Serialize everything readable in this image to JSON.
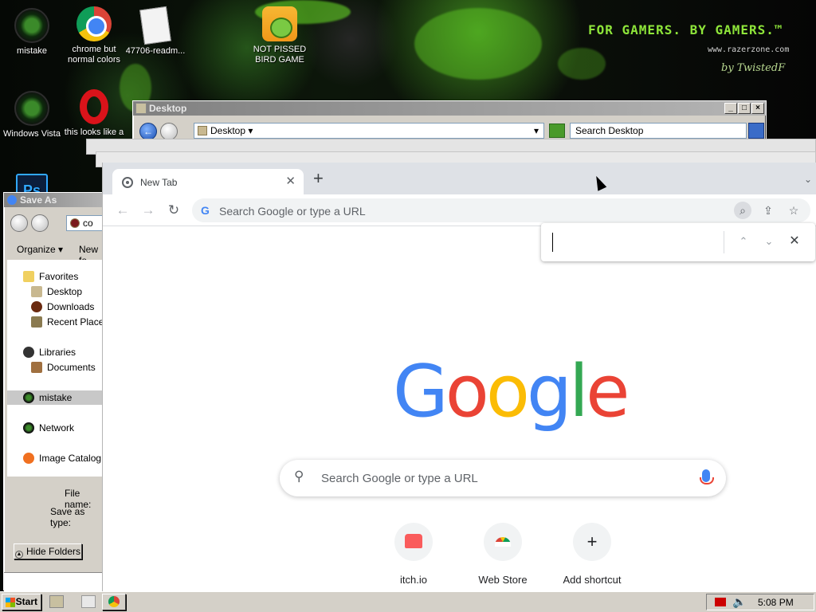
{
  "desktop": {
    "wallpaper": {
      "tagline": "FOR GAMERS. BY GAMERS.™",
      "site": "www.razerzone.com",
      "signature": "by TwistedF"
    },
    "icons": [
      {
        "label": "mistake",
        "icon": "razer-icon"
      },
      {
        "label": "chrome but normal colors",
        "icon": "chrome-icon"
      },
      {
        "label": "47706-readm...",
        "icon": "document-icon"
      },
      {
        "label": "NOT PISSED BIRD GAME",
        "icon": "bird-game-icon"
      },
      {
        "label": "Windows Vista",
        "icon": "razer-icon"
      },
      {
        "label": "this looks like a",
        "icon": "opera-icon"
      },
      {
        "label": "Ps",
        "icon": "photoshop-icon"
      }
    ]
  },
  "explorer": {
    "title": "Desktop",
    "address": "Desktop",
    "search_placeholder": "Search Desktop"
  },
  "save_as": {
    "title": "Save As",
    "address_fragment": "co",
    "organize": "Organize ▾",
    "new_folder": "New fo",
    "tree": [
      {
        "label": "Favorites",
        "level": 0
      },
      {
        "label": "Desktop",
        "level": 1
      },
      {
        "label": "Downloads",
        "level": 1
      },
      {
        "label": "Recent Places",
        "level": 1
      },
      {
        "label": "Libraries",
        "level": 0
      },
      {
        "label": "Documents",
        "level": 1
      },
      {
        "label": "mistake",
        "level": 0,
        "selected": true
      },
      {
        "label": "Network",
        "level": 0
      },
      {
        "label": "Image Catalog",
        "level": 0
      }
    ],
    "file_name_label": "File name:",
    "save_type_label": "Save as type:",
    "hide_folders": "Hide Folders"
  },
  "chrome": {
    "tab_title": "New Tab",
    "omnibox_placeholder": "Search Google or type a URL",
    "find_value": "",
    "google_logo": "Google",
    "ntp_search_placeholder": "Search Google or type a URL",
    "shortcuts": [
      {
        "label": "itch.io",
        "icon": "itch-icon"
      },
      {
        "label": "Web Store",
        "icon": "web-store-icon"
      },
      {
        "label": "Add shortcut",
        "icon": "plus-icon"
      }
    ],
    "colors": {
      "blue": "#4285f4",
      "red": "#ea4335",
      "yellow": "#fbbc05",
      "green": "#34a853"
    }
  },
  "taskbar": {
    "start": "Start",
    "clock": "5:08 PM"
  }
}
